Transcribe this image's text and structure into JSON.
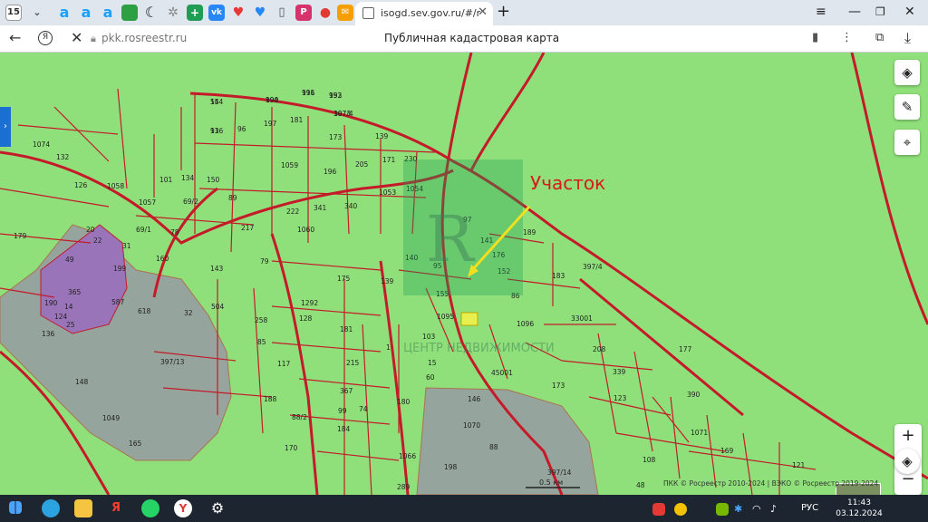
{
  "browser": {
    "tab_count": "15",
    "active_tab_title": "isogd.sev.gov.ru/#/map?z",
    "new_tab": "+",
    "url": "pkk.rosreestr.ru",
    "page_title": "Публичная кадастровая карта"
  },
  "map": {
    "annotation": "Участок",
    "watermark": "ЦЕНТР НЕДВИЖИМОСТИ",
    "controls": {
      "zoom_in": "+",
      "zoom_out": "−",
      "more": "•••"
    },
    "copyright": "ПКК © Росреестр 2010-2024 | ВЭКО © Росреестр 2019-2024",
    "scale_label": "0.5 км",
    "colors": {
      "land": "#8fe07a",
      "border": "#c41a2a",
      "urban": "#9a74b8"
    },
    "parcels": [
      "154",
      "990",
      "991",
      "992",
      "1073",
      "93",
      "96",
      "197",
      "181",
      "173",
      "139",
      "1074",
      "132",
      "134",
      "150",
      "1059",
      "196",
      "205",
      "171",
      "230",
      "126",
      "1058",
      "101",
      "69/2",
      "1057",
      "89",
      "222",
      "341",
      "340",
      "1053",
      "1054",
      "97",
      "179",
      "20",
      "22",
      "69/1",
      "78",
      "217",
      "1060",
      "141",
      "176",
      "189",
      "49",
      "31",
      "160",
      "143",
      "79",
      "140",
      "152",
      "175",
      "397/4",
      "199",
      "183",
      "365",
      "14",
      "587",
      "139",
      "95",
      "155",
      "86",
      "190",
      "25",
      "618",
      "504",
      "1292",
      "1095",
      "33001",
      "124",
      "32",
      "258",
      "128",
      "181",
      "1096",
      "136",
      "85",
      "1",
      "103",
      "177",
      "397/13",
      "215",
      "45001",
      "208",
      "117",
      "15",
      "339",
      "148",
      "60",
      "173",
      "390",
      "188",
      "367",
      "180",
      "146",
      "123",
      "1049",
      "88/2",
      "99",
      "74",
      "184",
      "1070",
      "1071",
      "165",
      "170",
      "1066",
      "88",
      "169",
      "108",
      "121",
      "48",
      "289",
      "198",
      "397/14",
      "54",
      "194",
      "116",
      "153",
      "397/4",
      "116"
    ]
  },
  "taskbar": {
    "lang": "РУС",
    "time": "11:43",
    "date": "03.12.2024"
  }
}
